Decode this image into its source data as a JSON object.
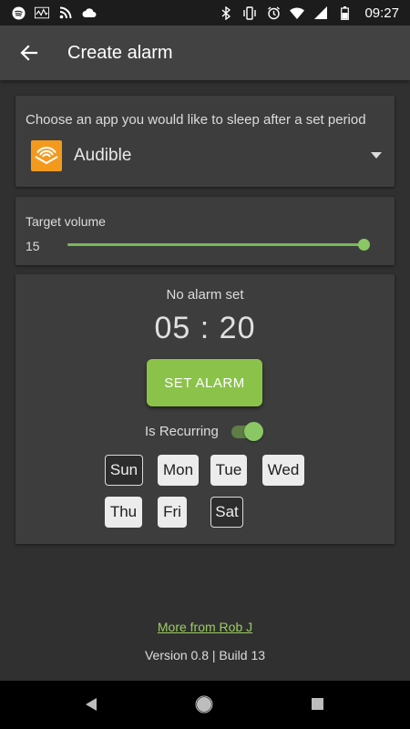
{
  "status_bar": {
    "time": "09:27",
    "left_icons": [
      "spotify-icon",
      "activity-icon",
      "rss-icon",
      "cloud-icon"
    ],
    "right_icons": [
      "bluetooth-icon",
      "vibrate-icon",
      "alarm-icon",
      "wifi-icon",
      "signal-icon",
      "battery-icon"
    ]
  },
  "app_bar": {
    "title": "Create alarm",
    "back_icon": "arrow-back-icon"
  },
  "app_picker": {
    "label": "Choose an app you would like to sleep after a set period",
    "selected_app": "Audible",
    "app_icon": "audible-logo",
    "dropdown_icon": "dropdown-arrow-icon"
  },
  "volume": {
    "label": "Target volume",
    "value": "15",
    "fraction": 1.0
  },
  "alarm": {
    "status": "No alarm set",
    "time": "05 : 20",
    "set_button": "SET ALARM",
    "recurring_label": "Is Recurring",
    "recurring": true
  },
  "days": [
    {
      "label": "Sun",
      "selected": false
    },
    {
      "label": "Mon",
      "selected": true
    },
    {
      "label": "Tue",
      "selected": true
    },
    {
      "label": "Wed",
      "selected": true
    },
    {
      "label": "Thu",
      "selected": true
    },
    {
      "label": "Fri",
      "selected": true
    },
    {
      "label": "Sat",
      "selected": false
    }
  ],
  "footer": {
    "link": "More from Rob J",
    "version": "Version 0.8 | Build 13"
  },
  "colors": {
    "accent": "#8bc34a",
    "background": "#303030",
    "card": "#3d3d3d",
    "app_bar": "#424242",
    "audible": "#f39a1e"
  }
}
